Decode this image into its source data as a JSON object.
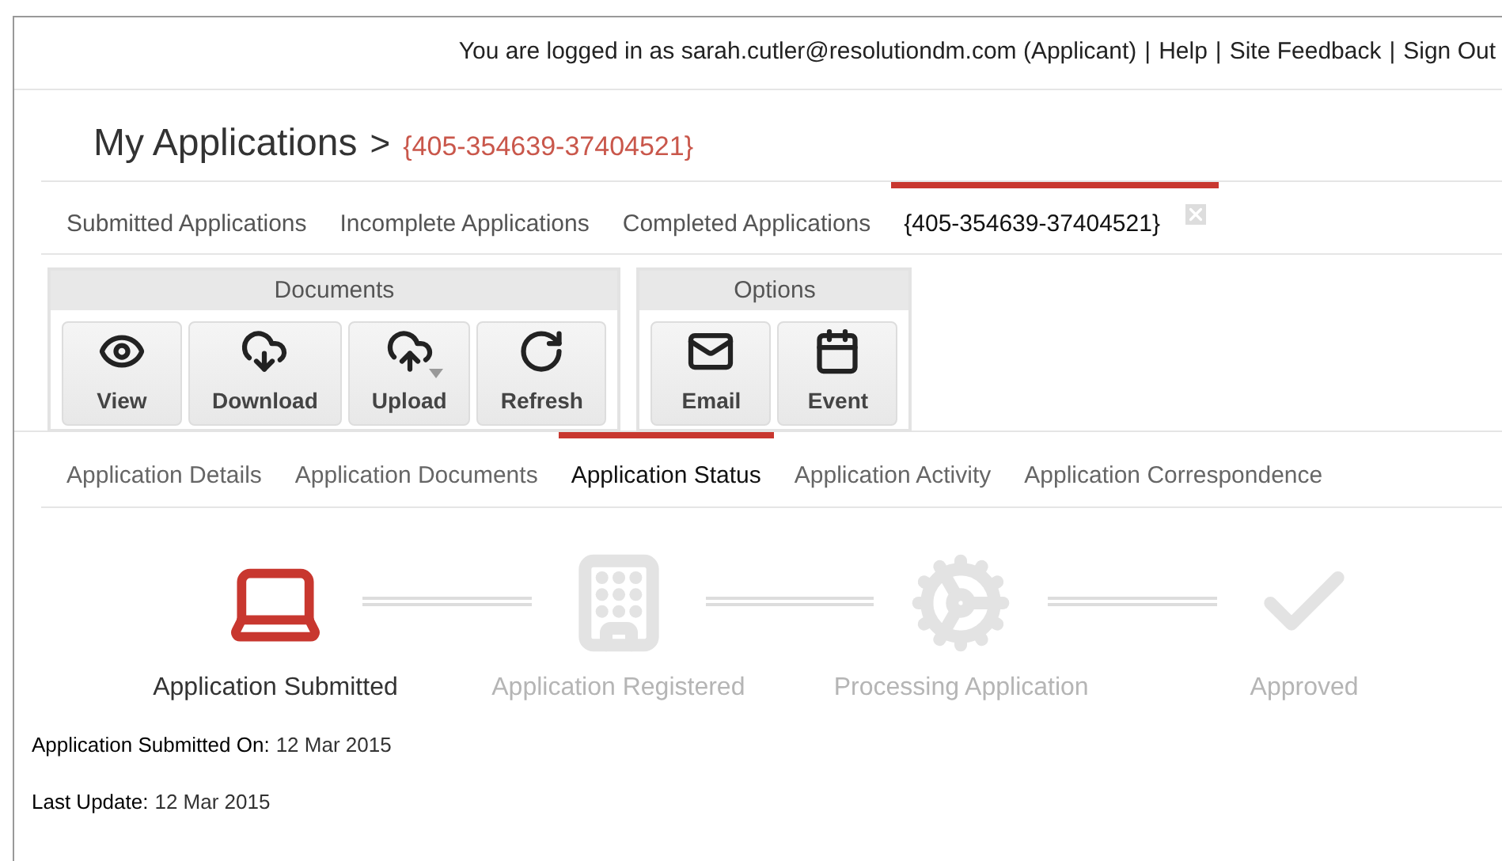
{
  "header": {
    "login_text": "You are logged in as sarah.cutler@resolutiondm.com (Applicant)",
    "separator": "|",
    "links": [
      "Help",
      "Site Feedback",
      "Sign Out"
    ]
  },
  "breadcrumb": {
    "root": "My Applications",
    "separator": ">",
    "current": "{405-354639-37404521}"
  },
  "tabs": [
    {
      "label": "Submitted Applications",
      "selected": false,
      "closable": false
    },
    {
      "label": "Incomplete Applications",
      "selected": false,
      "closable": false
    },
    {
      "label": "Completed Applications",
      "selected": false,
      "closable": false
    },
    {
      "label": "{405-354639-37404521}",
      "selected": true,
      "closable": true
    }
  ],
  "toolbar": [
    {
      "title": "Documents",
      "buttons": [
        {
          "label": "View",
          "has_menu": false
        },
        {
          "label": "Download",
          "has_menu": false
        },
        {
          "label": "Upload",
          "has_menu": true
        },
        {
          "label": "Refresh",
          "has_menu": false
        }
      ]
    },
    {
      "title": "Options",
      "buttons": [
        {
          "label": "Email",
          "has_menu": false
        },
        {
          "label": "Event",
          "has_menu": false
        }
      ]
    }
  ],
  "detail_tabs": [
    {
      "label": "Application Details",
      "selected": false
    },
    {
      "label": "Application Documents",
      "selected": false
    },
    {
      "label": "Application Status",
      "selected": true
    },
    {
      "label": "Application Activity",
      "selected": false
    },
    {
      "label": "Application Correspondence",
      "selected": false
    }
  ],
  "steps": [
    {
      "label": "Application Submitted",
      "done": true
    },
    {
      "label": "Application Registered",
      "done": false
    },
    {
      "label": "Processing Application",
      "done": false
    },
    {
      "label": "Approved",
      "done": false
    }
  ],
  "info": [
    {
      "label": "Application Submitted On:",
      "value": "12 Mar 2015"
    },
    {
      "label": "Last Update:",
      "value": "12 Mar 2015"
    }
  ]
}
